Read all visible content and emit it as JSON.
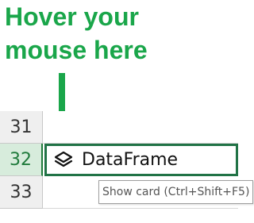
{
  "annotation": {
    "line1": "Hover your",
    "line2": "mouse here",
    "color": "#1aa64a"
  },
  "rows": [
    {
      "number": "31",
      "content": "",
      "selected": false
    },
    {
      "number": "32",
      "content": "DataFrame",
      "selected": true,
      "icon": "layers-icon"
    },
    {
      "number": "33",
      "content": "",
      "selected": false
    }
  ],
  "tooltip": {
    "text": "Show card (Ctrl+Shift+F5)"
  },
  "colors": {
    "selection": "#217346",
    "selected_header_bg": "#d7ecdc",
    "header_bg": "#efefef"
  }
}
